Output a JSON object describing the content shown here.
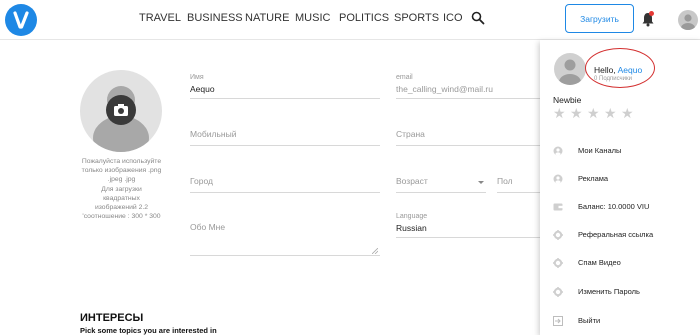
{
  "nav": {
    "items": [
      "TRAVEL",
      "BUSINESS",
      "NATURE",
      "MUSIC",
      "POLITICS",
      "SPORTS",
      "ICO"
    ],
    "upload_label": "Загрузить"
  },
  "profile": {
    "photo_note": "Пожалуйста используйте\nтолько изображения .png\n.jpeg .jpg\nДля загрузки\nквадратных\nизображений 2.2\n'соотношение : 300 * 300"
  },
  "form": {
    "name": {
      "label": "Имя",
      "value": "Aequo"
    },
    "email": {
      "label": "email",
      "value": "the_calling_wind@mail.ru"
    },
    "mobile": {
      "placeholder": "Мобильный"
    },
    "country": {
      "placeholder": "Страна"
    },
    "city": {
      "placeholder": "Город"
    },
    "age": {
      "placeholder": "Возраст"
    },
    "gender": {
      "placeholder": "Пол"
    },
    "about": {
      "placeholder": "Обо Мне"
    },
    "language": {
      "label": "Language",
      "value": "Russian"
    }
  },
  "interests": {
    "title": "ИНТЕРЕСЫ",
    "subtitle": "Pick some topics you are interested in"
  },
  "dropdown": {
    "hello_prefix": "Hello,",
    "username": "Aequo",
    "subscribers": "0 Подписчики",
    "rank": "Newbie",
    "rating": 0,
    "menu": [
      {
        "label": "Мои Каналы",
        "icon": "user-icon"
      },
      {
        "label": "Реклама",
        "icon": "user-icon"
      },
      {
        "label": "Баланс: 10.0000 VIU",
        "icon": "wallet-icon"
      },
      {
        "label": "Реферальная ссылка",
        "icon": "gear-icon"
      },
      {
        "label": "Спам Видео",
        "icon": "gear-icon"
      },
      {
        "label": "Изменить Пароль",
        "icon": "gear-icon"
      },
      {
        "label": "Выйти",
        "icon": "logout-icon"
      }
    ]
  },
  "colors": {
    "accent": "#1e88e5",
    "annotation": "#d32f2f"
  }
}
